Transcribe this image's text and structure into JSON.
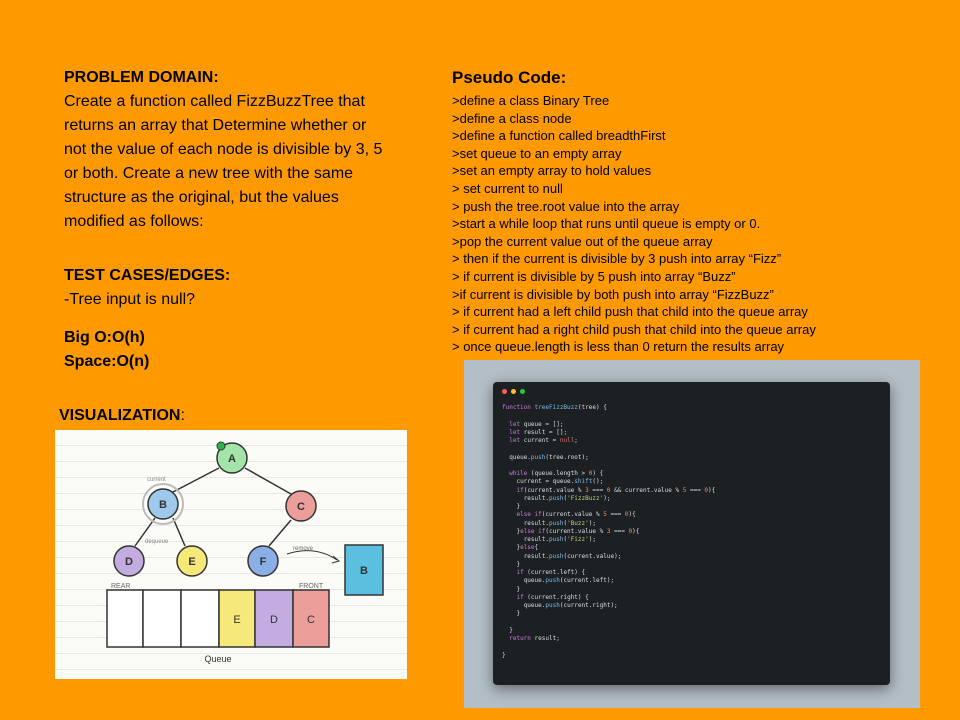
{
  "problem": {
    "heading": "PROBLEM DOMAIN:",
    "lines": [
      "Create a function called FizzBuzzTree that",
      "returns an array that Determine whether or",
      "not the value of each node is divisible by 3, 5",
      "or both. Create a new tree with the same",
      "structure as the original, but the values",
      "modified as follows:"
    ]
  },
  "tests": {
    "heading": "TEST CASES/EDGES:",
    "text": "-Tree input is null?"
  },
  "complexity": {
    "time": "Big O:O(h)",
    "space": "Space:O(n)"
  },
  "visualization": {
    "heading": "VISUALIZATION",
    "colon": ":",
    "nodes": {
      "a": "A",
      "b": "B",
      "c": "C",
      "d": "D",
      "e": "E",
      "f": "F"
    },
    "current_box": "B",
    "queue_cells": [
      "E",
      "D",
      "C"
    ],
    "label_rear": "REAR",
    "label_front": "FRONT",
    "label_queue": "Queue",
    "label_current": "current",
    "label_dequeue": "dequeue",
    "label_remove": "remove"
  },
  "pseudo": {
    "heading": "Pseudo Code:",
    "lines": [
      ">define a class Binary Tree",
      ">define a class node",
      ">define a function called breadthFirst",
      ">set queue to an empty array",
      ">set an empty array to hold values",
      "> set current to null",
      "> push the tree.root value into the array",
      ">start a while loop that runs until queue is empty or 0.",
      ">pop the current value out of the queue array",
      "> then if the current is divisible by 3 push into array  “Fizz”",
      "> if current is divisible by 5 push into array “Buzz”",
      ">if current is divisible by both push into array “FizzBuzz”",
      "> if current had a left child push that child into the queue array",
      "> if current had a right child push that child into the queue array",
      "> once queue.length is less than 0 return the results array"
    ]
  },
  "code": {
    "window_dots": [
      "#ff5f56",
      "#ffbd2e",
      "#27c93f"
    ],
    "colors": {
      "keyword": "#cc7be0",
      "function": "#78bdf0",
      "string": "#b8d982",
      "number": "#f08c6c"
    },
    "lines": [
      "function treeFizzBuzz(tree) {",
      "",
      "  let queue = [];",
      "  let result = [];",
      "  let current = null;",
      "",
      "  queue.push(tree.root);",
      "",
      "  while (queue.length > 0) {",
      "    current = queue.shift();",
      "    if(current.value % 3 === 0 && current.value % 5 === 0){",
      "      result.push('FizzBuzz');",
      "    }",
      "    else if(current.value % 5 === 0){",
      "      result.push('Buzz');",
      "    }else if(current.value % 3 === 0){",
      "      result.push('Fizz');",
      "    }else{",
      "      result.push(current.value);",
      "    }",
      "    if (current.left) {",
      "      queue.push(current.left);",
      "    }",
      "    if (current.right) {",
      "      queue.push(current.right);",
      "    }",
      "",
      "  }",
      "  return result;",
      "",
      "}"
    ]
  }
}
